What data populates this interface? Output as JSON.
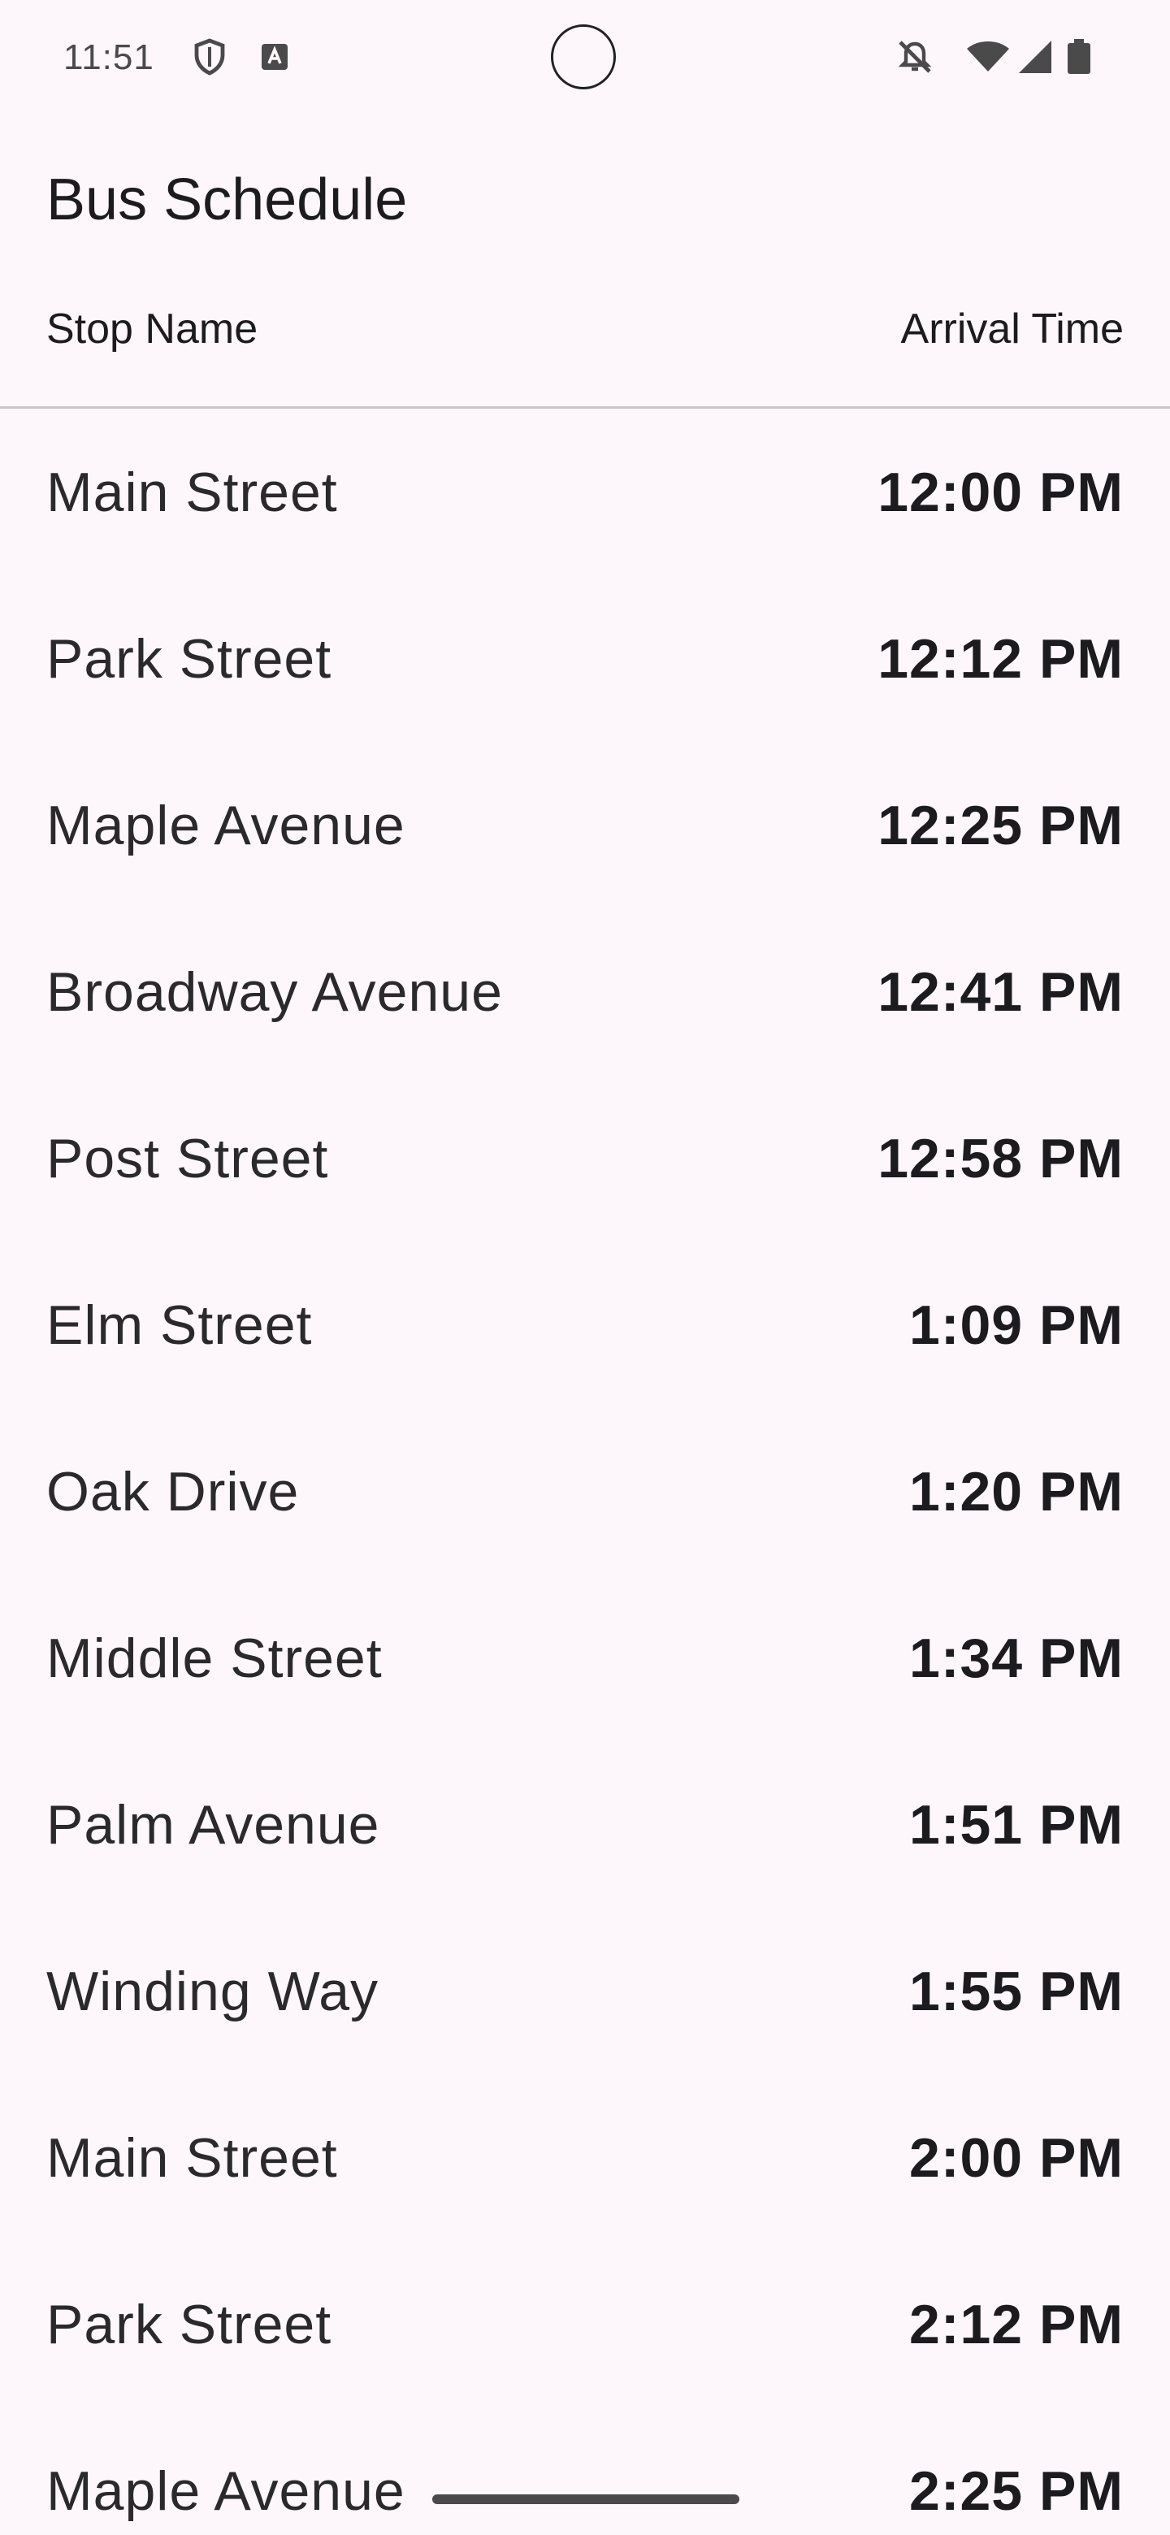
{
  "status_bar": {
    "time": "11:51",
    "left_icons": [
      "shield-icon",
      "keyboard-a-icon"
    ],
    "right_icons": [
      "mute-icon",
      "wifi-icon",
      "cell-signal-icon",
      "battery-icon"
    ]
  },
  "app": {
    "title": "Bus Schedule"
  },
  "table": {
    "headers": {
      "stop": "Stop Name",
      "time": "Arrival Time"
    },
    "rows": [
      {
        "stop": "Main Street",
        "time": "12:00 PM"
      },
      {
        "stop": "Park Street",
        "time": "12:12 PM"
      },
      {
        "stop": "Maple Avenue",
        "time": "12:25 PM"
      },
      {
        "stop": "Broadway Avenue",
        "time": "12:41 PM"
      },
      {
        "stop": "Post Street",
        "time": "12:58 PM"
      },
      {
        "stop": "Elm Street",
        "time": "1:09 PM"
      },
      {
        "stop": "Oak Drive",
        "time": "1:20 PM"
      },
      {
        "stop": "Middle Street",
        "time": "1:34 PM"
      },
      {
        "stop": "Palm Avenue",
        "time": "1:51 PM"
      },
      {
        "stop": "Winding Way",
        "time": "1:55 PM"
      },
      {
        "stop": "Main Street",
        "time": "2:00 PM"
      },
      {
        "stop": "Park Street",
        "time": "2:12 PM"
      },
      {
        "stop": "Maple Avenue",
        "time": "2:25 PM"
      }
    ]
  },
  "colors": {
    "background": "#fdf7fb",
    "text": "#1c1b1f",
    "divider": "#c9c5ca"
  }
}
